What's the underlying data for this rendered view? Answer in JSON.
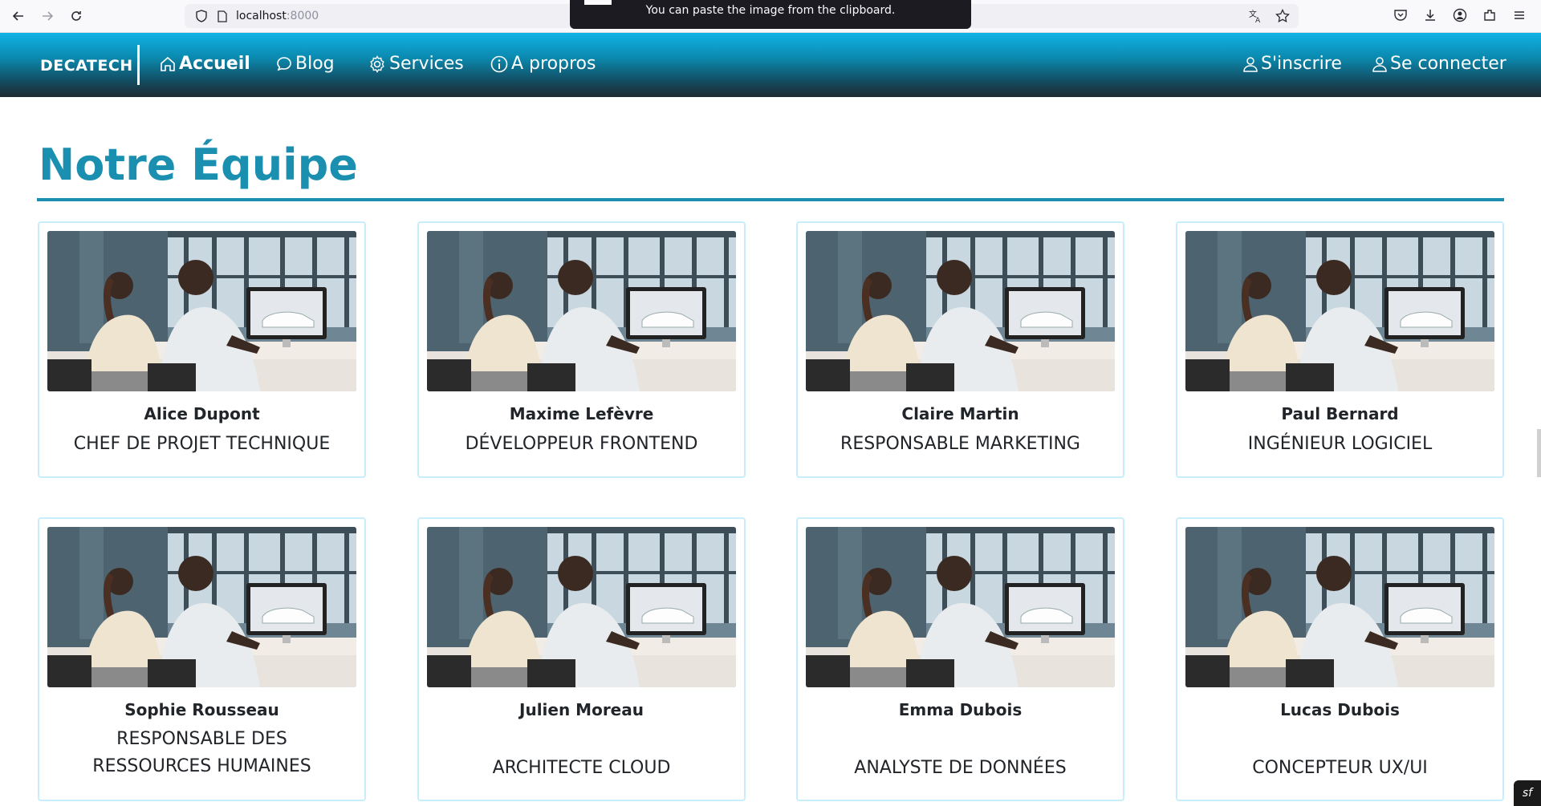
{
  "browser": {
    "url_host": "localhost",
    "url_port": ":8000",
    "paste_tooltip": "You can paste the image from the clipboard."
  },
  "nav": {
    "brand": "DECATECH",
    "links": [
      {
        "label": "Accueil",
        "icon": "home-icon"
      },
      {
        "label": "Blog",
        "icon": "chat-bubble-icon"
      },
      {
        "label": "Services",
        "icon": "gear-icon"
      },
      {
        "label": "A propros",
        "icon": "info-icon"
      }
    ],
    "signup": "S'inscrire",
    "login": "Se connecter"
  },
  "section": {
    "title": "Notre Équipe"
  },
  "team": [
    {
      "name": "Alice Dupont",
      "role": "CHEF DE PROJET TECHNIQUE"
    },
    {
      "name": "Maxime Lefèvre",
      "role": "DÉVELOPPEUR FRONTEND"
    },
    {
      "name": "Claire Martin",
      "role": "RESPONSABLE MARKETING"
    },
    {
      "name": "Paul Bernard",
      "role": "INGÉNIEUR LOGICIEL"
    },
    {
      "name": "Sophie Rousseau",
      "role": "RESPONSABLE DES RESSOURCES HUMAINES"
    },
    {
      "name": "Julien Moreau",
      "role": "ARCHITECTE CLOUD"
    },
    {
      "name": "Emma Dubois",
      "role": "ANALYSTE DE DONNÉES"
    },
    {
      "name": "Lucas Dubois",
      "role": "CONCEPTEUR UX/UI"
    }
  ],
  "colors": {
    "accent": "#1a8fb0",
    "card_border": "#c8eefb"
  }
}
